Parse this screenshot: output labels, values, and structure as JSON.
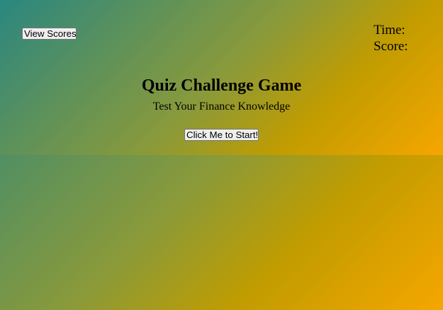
{
  "header": {
    "view_scores_label": "View Scores",
    "time_label": "Time:",
    "score_label": "Score:"
  },
  "main": {
    "title": "Quiz Challenge Game",
    "subtitle": "Test Your Finance Knowledge",
    "start_label": "Click Me to Start!"
  },
  "colors": {
    "gradient_start": "#2a8780",
    "gradient_mid": "#8a9a3a",
    "gradient_gold": "#c19c00",
    "gradient_end": "#f6a600"
  }
}
